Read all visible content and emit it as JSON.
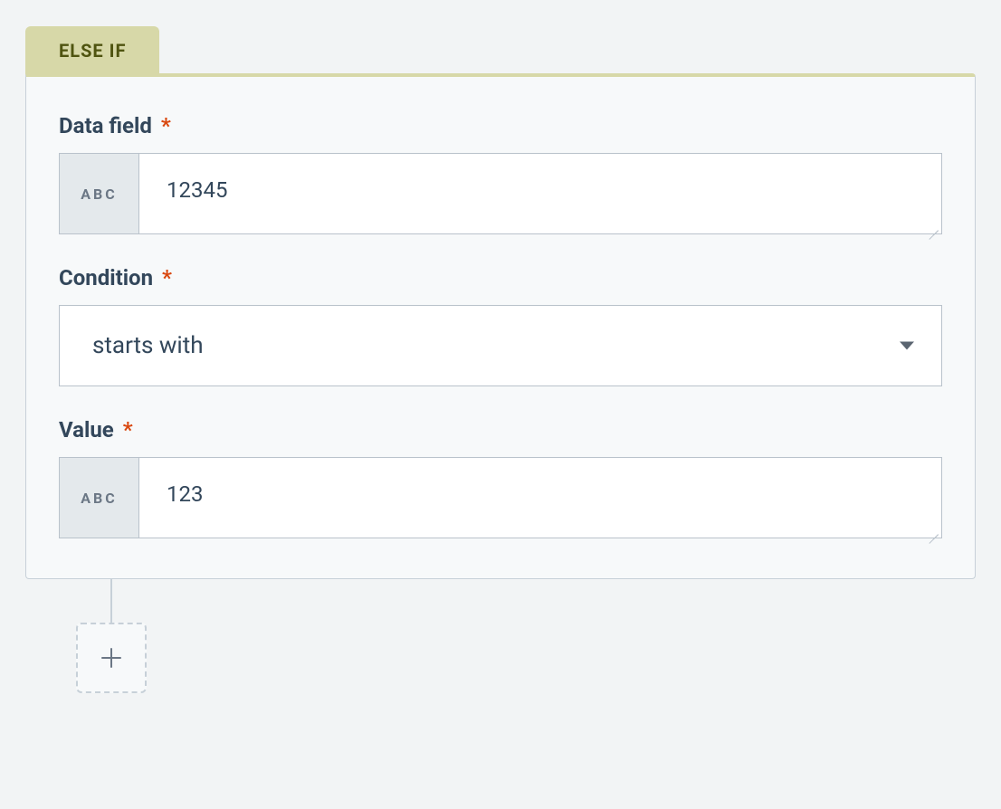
{
  "tab": {
    "label": "ELSE IF"
  },
  "prefix_text": "ABC",
  "fields": {
    "data_field": {
      "label": "Data field",
      "required_marker": "*",
      "value": "12345"
    },
    "condition": {
      "label": "Condition",
      "required_marker": "*",
      "selected": "starts with"
    },
    "value": {
      "label": "Value",
      "required_marker": "*",
      "value": "123"
    }
  }
}
